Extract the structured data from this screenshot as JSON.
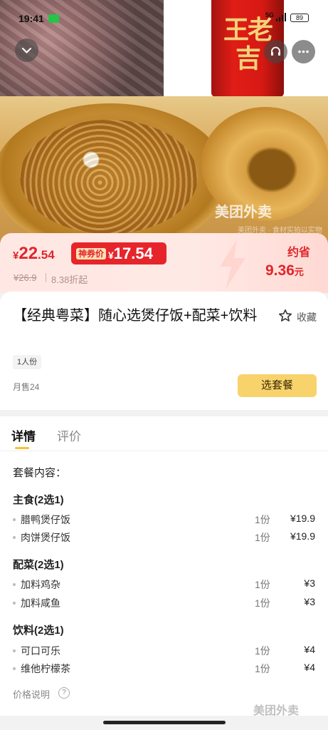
{
  "status_bar": {
    "time": "19:41",
    "network": "5G",
    "battery": "89"
  },
  "hero": {
    "can_brand": "王老吉",
    "watermark": "美团外卖",
    "watermark_sub": "美团外卖 · 食材实拍以实物为准"
  },
  "price": {
    "current_yen": "¥",
    "current_int": "22",
    "current_dec": ".54",
    "coupon_label": "神券价",
    "coupon_yen": "¥",
    "coupon_price": "17.54",
    "original": "¥26.9",
    "discount": "8.38折起",
    "save_label": "约省",
    "save_amount": "9.36",
    "save_unit": "元"
  },
  "product": {
    "title": "【经典粤菜】随心选煲仔饭+配菜+饮料",
    "favorite_label": "收藏",
    "portion": "1人份",
    "monthly_sales": "月售24",
    "select_button": "选套餐"
  },
  "tabs": {
    "details": "详情",
    "reviews": "评价"
  },
  "package": {
    "title": "套餐内容：",
    "groups": [
      {
        "title": "主食(2选1)",
        "items": [
          {
            "name": "腊鸭煲仔饭",
            "qty": "1份",
            "price": "¥19.9"
          },
          {
            "name": "肉饼煲仔饭",
            "qty": "1份",
            "price": "¥19.9"
          }
        ]
      },
      {
        "title": "配菜(2选1)",
        "items": [
          {
            "name": "加料鸡杂",
            "qty": "1份",
            "price": "¥3"
          },
          {
            "name": "加料咸鱼",
            "qty": "1份",
            "price": "¥3"
          }
        ]
      },
      {
        "title": "饮料(2选1)",
        "items": [
          {
            "name": "可口可乐",
            "qty": "1份",
            "price": "¥4"
          },
          {
            "name": "维他柠檬茶",
            "qty": "1份",
            "price": "¥4"
          }
        ]
      }
    ],
    "price_note": "价格说明"
  },
  "footer": {
    "watermark": "美团外卖"
  },
  "colors": {
    "accent_red": "#e0252b",
    "button_yellow": "#f8d36b",
    "tab_underline": "#f5c233"
  }
}
